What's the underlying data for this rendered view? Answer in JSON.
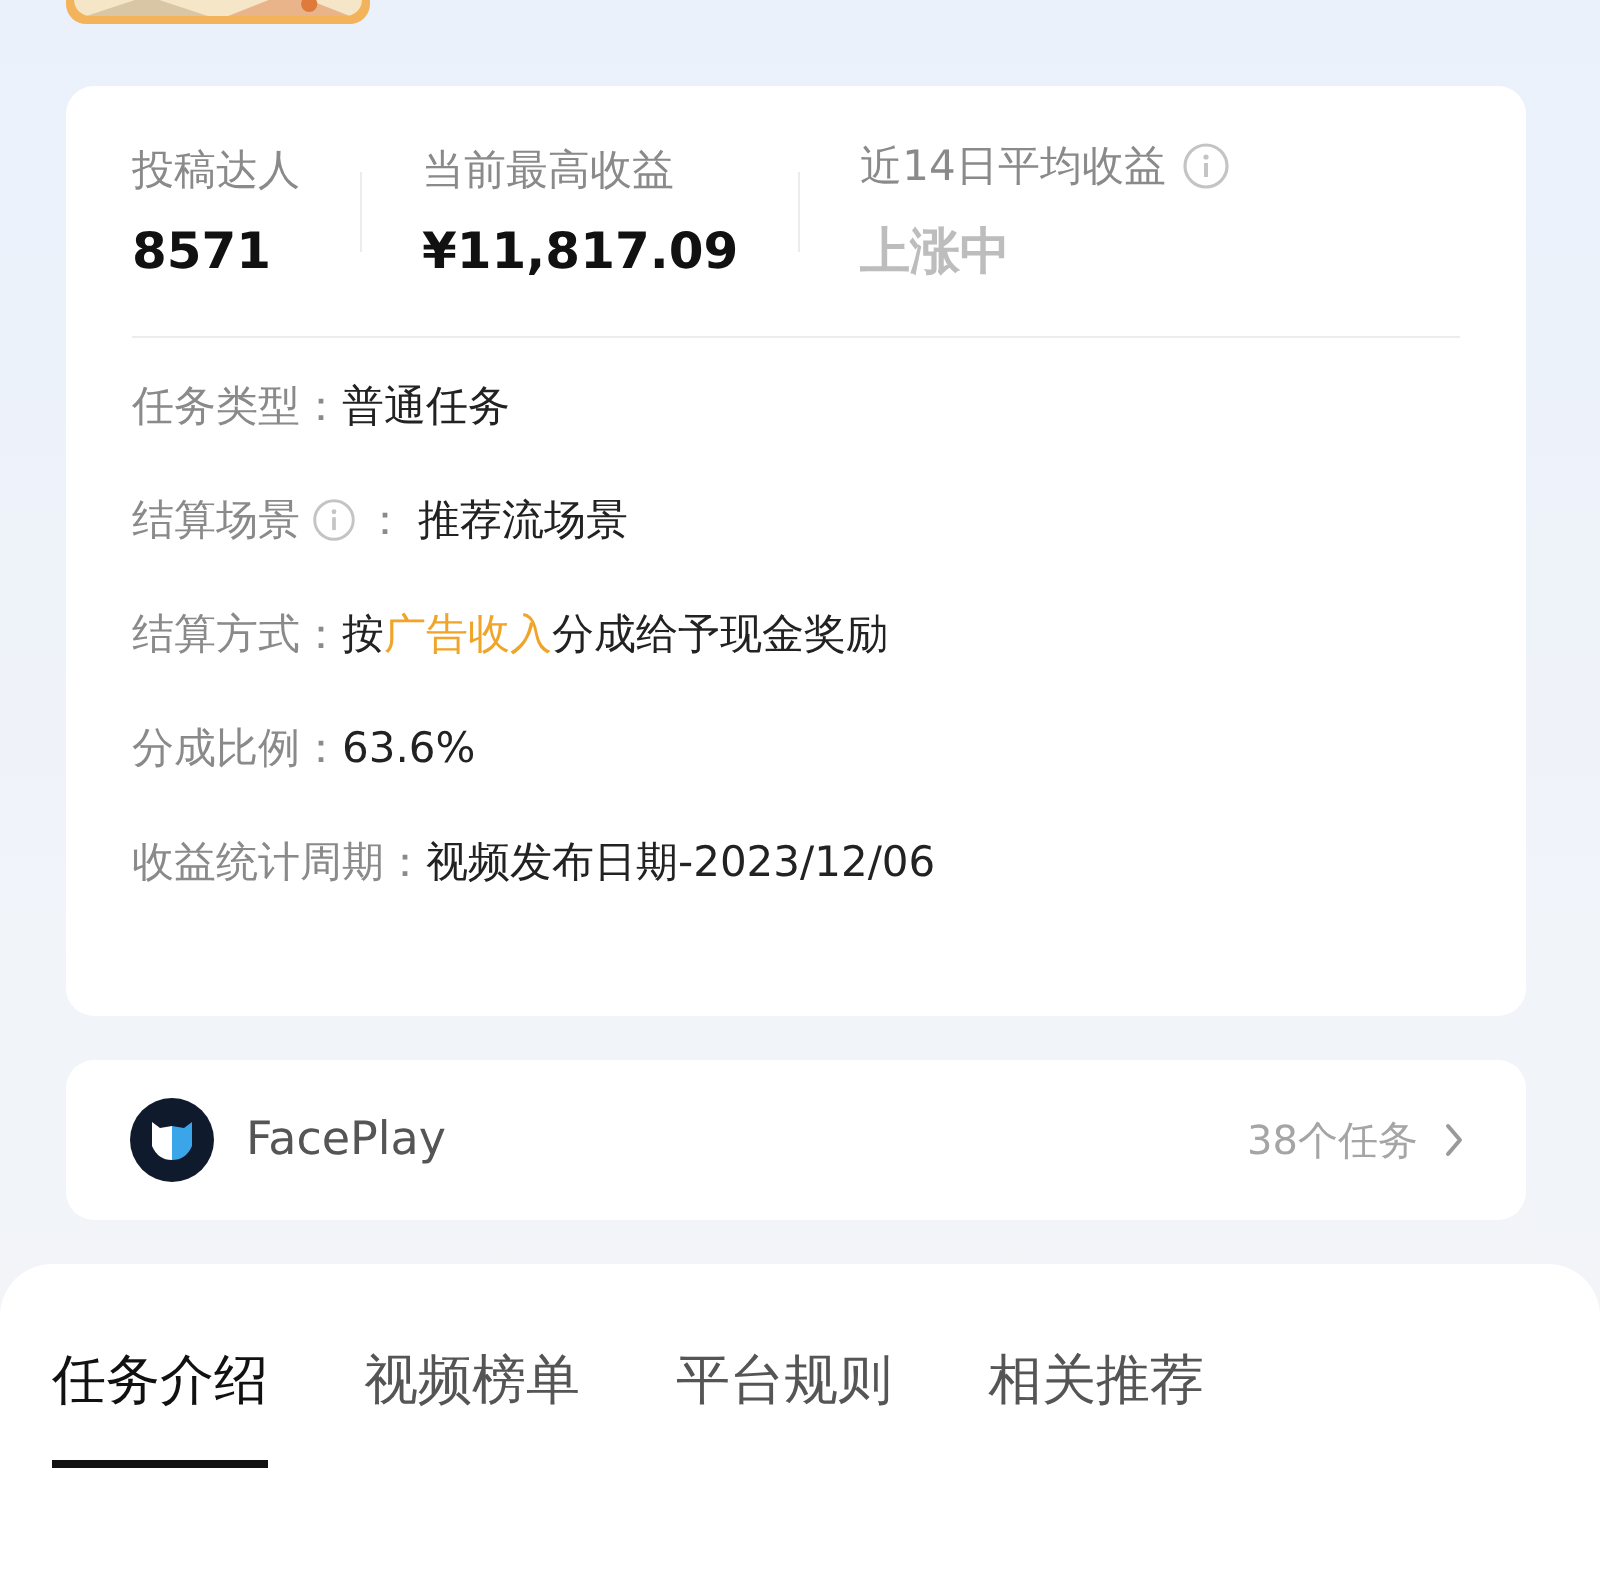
{
  "stats": [
    {
      "label": "投稿达人",
      "value": "8571",
      "muted": false,
      "info": false
    },
    {
      "label": "当前最高收益",
      "value": "¥11,817.09",
      "muted": false,
      "info": false
    },
    {
      "label": "近14日平均收益",
      "value": "上涨中",
      "muted": true,
      "info": true
    }
  ],
  "details": [
    {
      "label": "任务类型：",
      "info": false,
      "value": [
        {
          "text": "普通任务",
          "highlight": false
        }
      ]
    },
    {
      "label": "结算场景",
      "info": true,
      "separator": "：",
      "value": [
        {
          "text": "推荐流场景",
          "highlight": false
        }
      ]
    },
    {
      "label": "结算方式：",
      "info": false,
      "value": [
        {
          "text": "按",
          "highlight": false
        },
        {
          "text": "广告收入",
          "highlight": true
        },
        {
          "text": "分成给予现金奖励",
          "highlight": false
        }
      ]
    },
    {
      "label": "分成比例：",
      "info": false,
      "value": [
        {
          "text": "63.6%",
          "highlight": false
        }
      ]
    },
    {
      "label": "收益统计周期：",
      "info": false,
      "value": [
        {
          "text": "视频发布日期-2023/12/06",
          "highlight": false
        }
      ]
    }
  ],
  "app": {
    "name": "FacePlay",
    "task_count": "38个任务"
  },
  "tabs": [
    {
      "label": "任务介绍",
      "selected": true
    },
    {
      "label": "视频榜单",
      "selected": false
    },
    {
      "label": "平台规则",
      "selected": false
    },
    {
      "label": "相关推荐",
      "selected": false
    }
  ]
}
